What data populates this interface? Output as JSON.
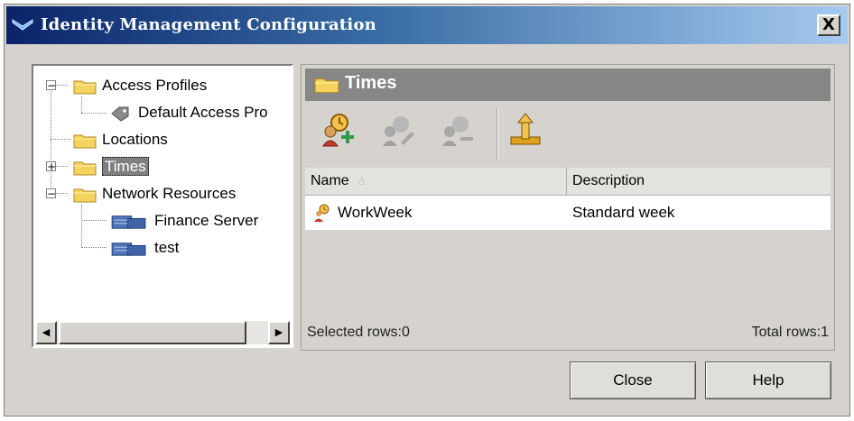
{
  "window": {
    "title": "Identity Management Configuration",
    "close_glyph": "X"
  },
  "tree": {
    "items": [
      {
        "label": "Access Profiles",
        "icon": "folder-icon",
        "expander": "−"
      },
      {
        "label": "Default Access Pro",
        "icon": "tag-icon"
      },
      {
        "label": "Locations",
        "icon": "folder-icon"
      },
      {
        "label": "Times",
        "icon": "folder-icon",
        "expander": "+",
        "selected": true
      },
      {
        "label": "Network Resources",
        "icon": "folder-icon",
        "expander": "−"
      },
      {
        "label": "Finance Server",
        "icon": "server-icon"
      },
      {
        "label": "test",
        "icon": "server-icon"
      }
    ],
    "scroll_left": "◀",
    "scroll_right": "▶"
  },
  "pane": {
    "title": "Times",
    "toolbar": [
      {
        "name": "add-time-icon",
        "enabled": true
      },
      {
        "name": "edit-time-icon",
        "enabled": false
      },
      {
        "name": "delete-time-icon",
        "enabled": false
      },
      {
        "name": "upload-icon",
        "enabled": true
      }
    ],
    "columns": [
      "Name",
      "Description"
    ],
    "sort_indicator": "Δ",
    "rows": [
      {
        "name": "WorkWeek",
        "description": "Standard week"
      }
    ],
    "status_selected": "Selected rows:0",
    "status_total": "Total rows:1"
  },
  "buttons": {
    "close": "Close",
    "help": "Help"
  },
  "colors": {
    "title_start": "#0a246a",
    "title_end": "#a6caf0",
    "folder": "#f4d35e",
    "pane_header": "#868686"
  }
}
